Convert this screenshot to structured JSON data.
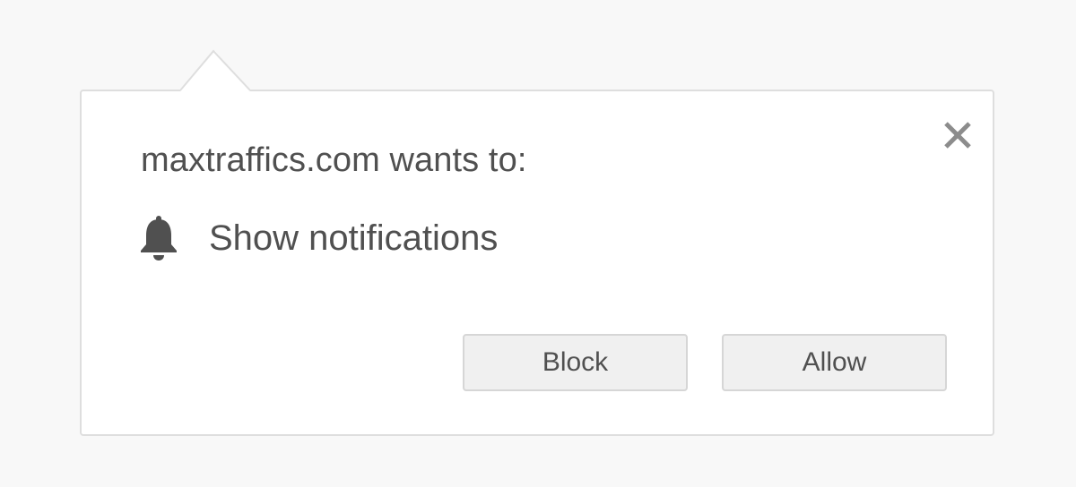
{
  "dialog": {
    "title": "maxtraffics.com wants to:",
    "permission": {
      "icon": "bell-icon",
      "label": "Show notifications"
    },
    "buttons": {
      "block_label": "Block",
      "allow_label": "Allow"
    },
    "close_icon": "close-icon"
  },
  "colors": {
    "text": "#505050",
    "background": "#f8f8f8",
    "popup_background": "#ffffff",
    "border": "#dedede",
    "button_background": "#f0f0f0",
    "close_icon": "#8c8c8c"
  }
}
